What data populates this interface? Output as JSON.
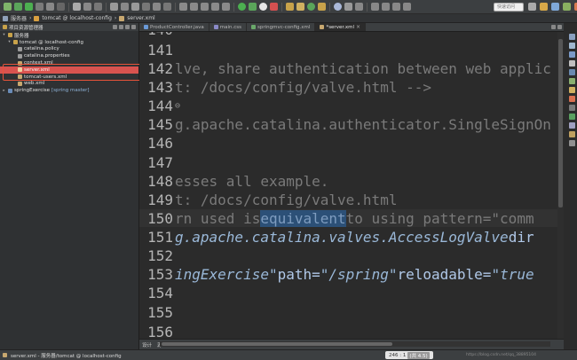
{
  "toolbar": {
    "quick_access_placeholder": "快速访问"
  },
  "breadcrumb": {
    "items": [
      "服务器",
      "tomcat @ localhost-config",
      "server.xml"
    ]
  },
  "left_panel": {
    "title": "项目资源管理器",
    "tree": [
      {
        "label": "服务器",
        "level": 0,
        "twisty": "▾"
      },
      {
        "label": "tomcat @ localhost-config",
        "level": 1,
        "twisty": "▾"
      },
      {
        "label": "catalina.policy",
        "level": 2,
        "twisty": ""
      },
      {
        "label": "catalina.properties",
        "level": 2,
        "twisty": ""
      },
      {
        "label": "context.xml",
        "level": 2,
        "twisty": ""
      },
      {
        "label": "server.xml",
        "level": 2,
        "twisty": "",
        "selected": true
      },
      {
        "label": "tomcat-users.xml",
        "level": 2,
        "twisty": ""
      },
      {
        "label": "web.xml",
        "level": 2,
        "twisty": ""
      },
      {
        "label": "springExercise",
        "git": "[spring master]",
        "level": 0,
        "twisty": "▸"
      }
    ]
  },
  "editor_tabs": [
    {
      "label": "ProductController.java",
      "active": false
    },
    {
      "label": "main.css",
      "active": false
    },
    {
      "label": "springmvc-config.xml",
      "active": false
    },
    {
      "label": "*server.xml",
      "active": true
    }
  ],
  "code_lines": [
    {
      "num": "140",
      "text": ""
    },
    {
      "num": "141",
      "text": ""
    },
    {
      "num": "142",
      "text": "lve, share authentication between web applic"
    },
    {
      "num": "143",
      "text": "t: /docs/config/valve.html -->"
    },
    {
      "num": "144",
      "text": ""
    },
    {
      "num": "145",
      "text": "g.apache.catalina.authenticator.SingleSignOn"
    },
    {
      "num": "146",
      "text": ""
    },
    {
      "num": "147",
      "text": ""
    },
    {
      "num": "148",
      "text": "esses all example."
    },
    {
      "num": "149",
      "text": "t: /docs/config/valve.html"
    },
    {
      "num": "150",
      "pre": "rn used is ",
      "sel": "equivalent",
      "post": " to using pattern=\"comm"
    },
    {
      "num": "151",
      "cls": "g.apache.catalina.valves.AccessLogValve",
      "post": " dir"
    },
    {
      "num": "152",
      "text": ""
    },
    {
      "num": "153",
      "v1": "ingExercise\"",
      "a1": " path=",
      "v2": "\"/spring\"",
      "a2": " reloadable=",
      "v3": "\"true"
    },
    {
      "num": "154",
      "text": ""
    },
    {
      "num": "155",
      "text": ""
    },
    {
      "num": "156",
      "text": ""
    }
  ],
  "design_bar": {
    "labels": [
      "设计",
      "源"
    ]
  },
  "status": {
    "left": "server.xml - 服务器/tomcat @ localhost-config",
    "position": "246 : 1",
    "position_extra": "(共 4.5)",
    "url": "https://blog.csdn.net/qq_38895104"
  },
  "colors": {
    "selection": "#2c5077",
    "highlight_box": "#e8533a",
    "selected_row": "#d9534f"
  }
}
